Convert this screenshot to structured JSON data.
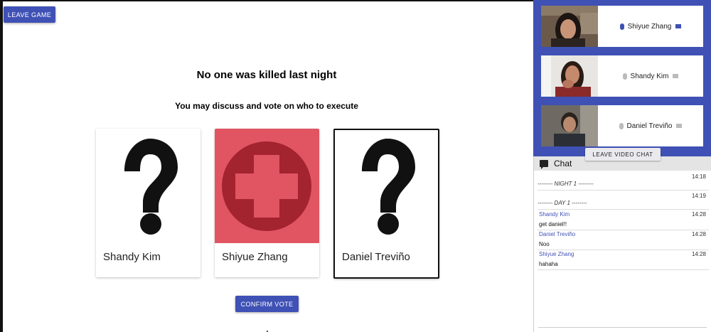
{
  "game": {
    "leave_label": "LEAVE GAME",
    "headline": "No one was killed last night",
    "subline": "You may discuss and vote on who to execute",
    "confirm_label": "CONFIRM VOTE",
    "cards": [
      {
        "name": "Shandy Kim",
        "art": "question-mark-icon",
        "selected": false
      },
      {
        "name": "Shiyue Zhang",
        "art": "medic-cross-icon",
        "selected": false
      },
      {
        "name": "Daniel Treviño",
        "art": "question-mark-icon",
        "selected": true
      }
    ]
  },
  "video": {
    "participants": [
      {
        "name": "Shiyue Zhang",
        "mic": "on",
        "camera": "on"
      },
      {
        "name": "Shandy Kim",
        "mic": "off",
        "camera": "off"
      },
      {
        "name": "Daniel Treviño",
        "mic": "off",
        "camera": "off"
      }
    ],
    "leave_label": "LEAVE VIDEO CHAT"
  },
  "chat": {
    "title": "Chat",
    "entries": [
      {
        "type": "system",
        "time": "14:18",
        "text": "-------- NIGHT 1 --------"
      },
      {
        "type": "system",
        "time": "14:19",
        "text": "-------- DAY 1 --------"
      },
      {
        "type": "message",
        "time": "14:28",
        "sender": "Shandy Kim",
        "text": "get daniel!!"
      },
      {
        "type": "message",
        "time": "14:28",
        "sender": "Daniel Treviño",
        "text": "Noo"
      },
      {
        "type": "message",
        "time": "14:28",
        "sender": "Shiyue Zhang",
        "text": "hahaha"
      }
    ]
  },
  "colors": {
    "accent": "#3f51b5",
    "medic_bg": "#e05561",
    "medic_circle": "#a3232f"
  }
}
